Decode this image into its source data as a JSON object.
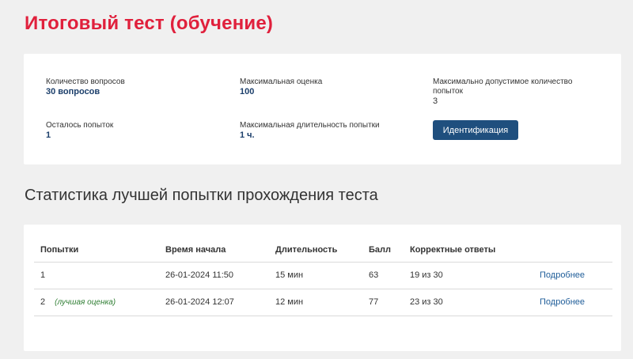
{
  "page": {
    "title": "Итоговый тест (обучение)"
  },
  "info": {
    "questions_label": "Количество вопросов",
    "questions_value": "30 вопросов",
    "max_score_label": "Максимальная оценка",
    "max_score_value": "100",
    "max_attempts_label": "Максимально допустимое количество попыток",
    "max_attempts_value": "3",
    "remaining_label": "Осталось попыток",
    "remaining_value": "1",
    "max_duration_label": "Максимальная длительность попытки",
    "max_duration_value": "1 ч.",
    "identify_button": "Идентификация"
  },
  "stats": {
    "title": "Статистика лучшей попытки прохождения теста",
    "columns": [
      "Попытки",
      "Время начала",
      "Длительность",
      "Балл",
      "Корректные ответы",
      ""
    ],
    "rows": [
      {
        "attempt": "1",
        "note": "",
        "start": "26-01-2024 11:50",
        "duration": "15 мин",
        "score": "63",
        "correct": "19 из 30",
        "link": "Подробнее"
      },
      {
        "attempt": "2",
        "note": "(лучшая оценка)",
        "start": "26-01-2024 12:07",
        "duration": "12 мин",
        "score": "77",
        "correct": "23 из 30",
        "link": "Подробнее"
      }
    ]
  },
  "colors": {
    "title": "#e0203c",
    "button": "#1f4f7e",
    "link": "#1f5d99",
    "best_note": "#2e7d32"
  }
}
